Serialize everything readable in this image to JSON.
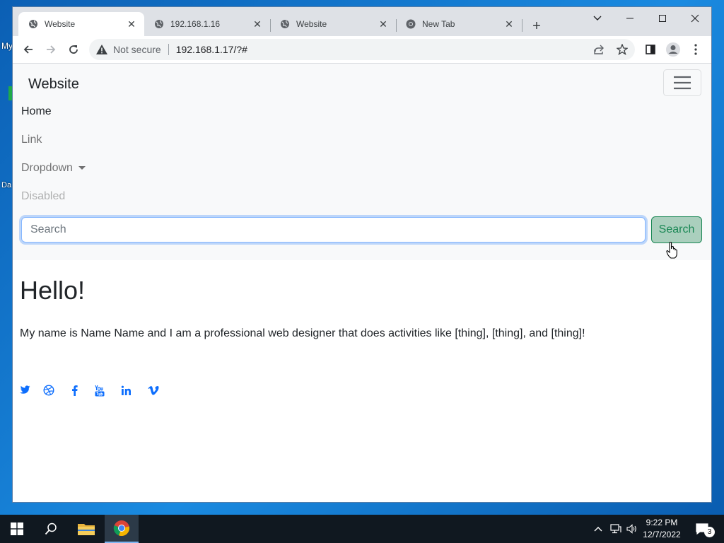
{
  "desktop": {
    "icon_labels": [
      "My",
      "Da"
    ]
  },
  "browser": {
    "tabs": [
      {
        "title": "Website",
        "active": true,
        "icon": "globe-icon"
      },
      {
        "title": "192.168.1.16",
        "active": false,
        "icon": "globe-icon"
      },
      {
        "title": "Website",
        "active": false,
        "icon": "globe-icon"
      },
      {
        "title": "New Tab",
        "active": false,
        "icon": "chrome-icon"
      }
    ],
    "new_tab_label": "+",
    "address": {
      "security_label": "Not secure",
      "url": "192.168.1.17/?#"
    }
  },
  "page": {
    "brand": "Website",
    "nav": {
      "home": "Home",
      "link": "Link",
      "dropdown": "Dropdown",
      "disabled": "Disabled"
    },
    "search": {
      "placeholder": "Search",
      "button": "Search"
    },
    "heading": "Hello!",
    "intro": "My name is Name Name and I am a professional web designer that does activities like [thing], [thing], and [thing]!",
    "social_icons": [
      "twitter-icon",
      "dribbble-icon",
      "facebook-icon",
      "youtube-icon",
      "linkedin-icon",
      "vimeo-icon"
    ],
    "accent_color": "#0d6efd",
    "button_color": "#198754"
  },
  "taskbar": {
    "time": "9:22 PM",
    "date": "12/7/2022",
    "notification_count": "3"
  }
}
